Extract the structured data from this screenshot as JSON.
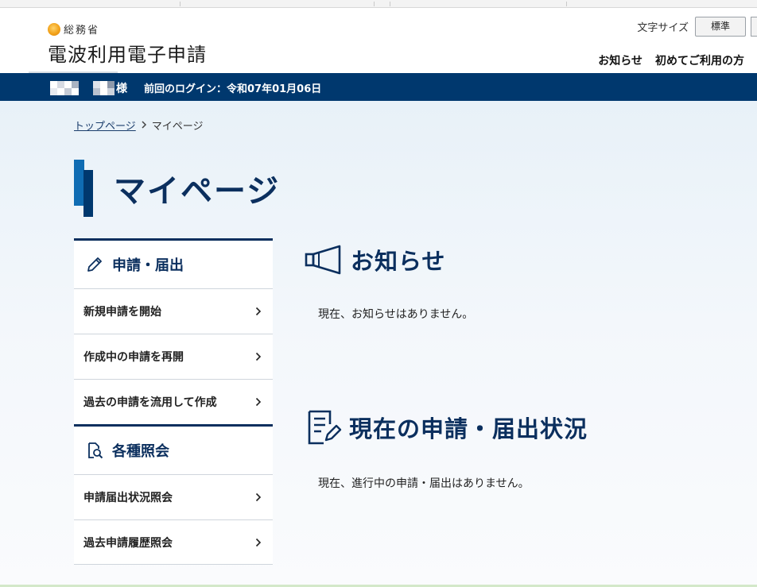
{
  "header": {
    "ministry": "総務省",
    "site_title": "電波利用電子申請",
    "font_size_label": "文字サイズ",
    "font_size_standard": "標準",
    "nav": [
      "お知らせ",
      "初めてご利用の方"
    ]
  },
  "userbar": {
    "user_suffix": "様",
    "last_login": "前回のログイン：令和07年01月06日"
  },
  "breadcrumb": {
    "home": "トップページ",
    "current": "マイページ"
  },
  "page": {
    "title": "マイページ"
  },
  "sidenav": {
    "group1": {
      "title": "申請・届出",
      "items": [
        "新規申請を開始",
        "作成中の申請を再開",
        "過去の申請を流用して作成"
      ]
    },
    "group2": {
      "title": "各種照会",
      "items": [
        "申請届出状況照会",
        "過去申請履歴照会"
      ]
    }
  },
  "content": {
    "notices_title": "お知らせ",
    "notices_text": "現在、お知らせはありません。",
    "status_title": "現在の申請・届出状況",
    "status_text": "現在、進行中の申請・届出はありません。"
  },
  "colors": {
    "brand_navy": "#00386e",
    "accent_blue": "#0f6cb3",
    "title_text": "#0b2f5e"
  }
}
